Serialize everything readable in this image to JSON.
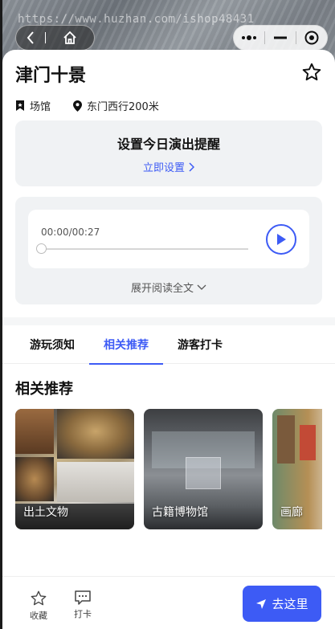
{
  "watermark": "https://www.huzhan.com/ishop48431",
  "detail": {
    "title": "津门十景",
    "category": "场馆",
    "location": "东门西行200米"
  },
  "reminder": {
    "title": "设置今日演出提醒",
    "link": "立即设置"
  },
  "audio": {
    "time": "00:00/00:27",
    "progress": 0,
    "expand_label": "展开阅读全文"
  },
  "tabs": [
    {
      "label": "游玩须知",
      "active": false
    },
    {
      "label": "相关推荐",
      "active": true
    },
    {
      "label": "游客打卡",
      "active": false
    }
  ],
  "recommend": {
    "title": "相关推荐",
    "items": [
      {
        "label": "出土文物"
      },
      {
        "label": "古籍博物馆"
      },
      {
        "label": "画廊"
      }
    ]
  },
  "bottom_bar": {
    "fav_label": "收藏",
    "checkin_label": "打卡",
    "go_label": "去这里"
  },
  "colors": {
    "accent": "#3d5bf5",
    "panel": "#f0f2f4"
  },
  "icons": [
    "back-icon",
    "home-icon",
    "more-icon",
    "minimize-icon",
    "close-target-icon",
    "star-icon",
    "bookmark-icon",
    "location-pin-icon",
    "chevron-right-icon",
    "play-icon",
    "chevron-down-icon",
    "chat-icon",
    "navigation-arrow-icon"
  ]
}
